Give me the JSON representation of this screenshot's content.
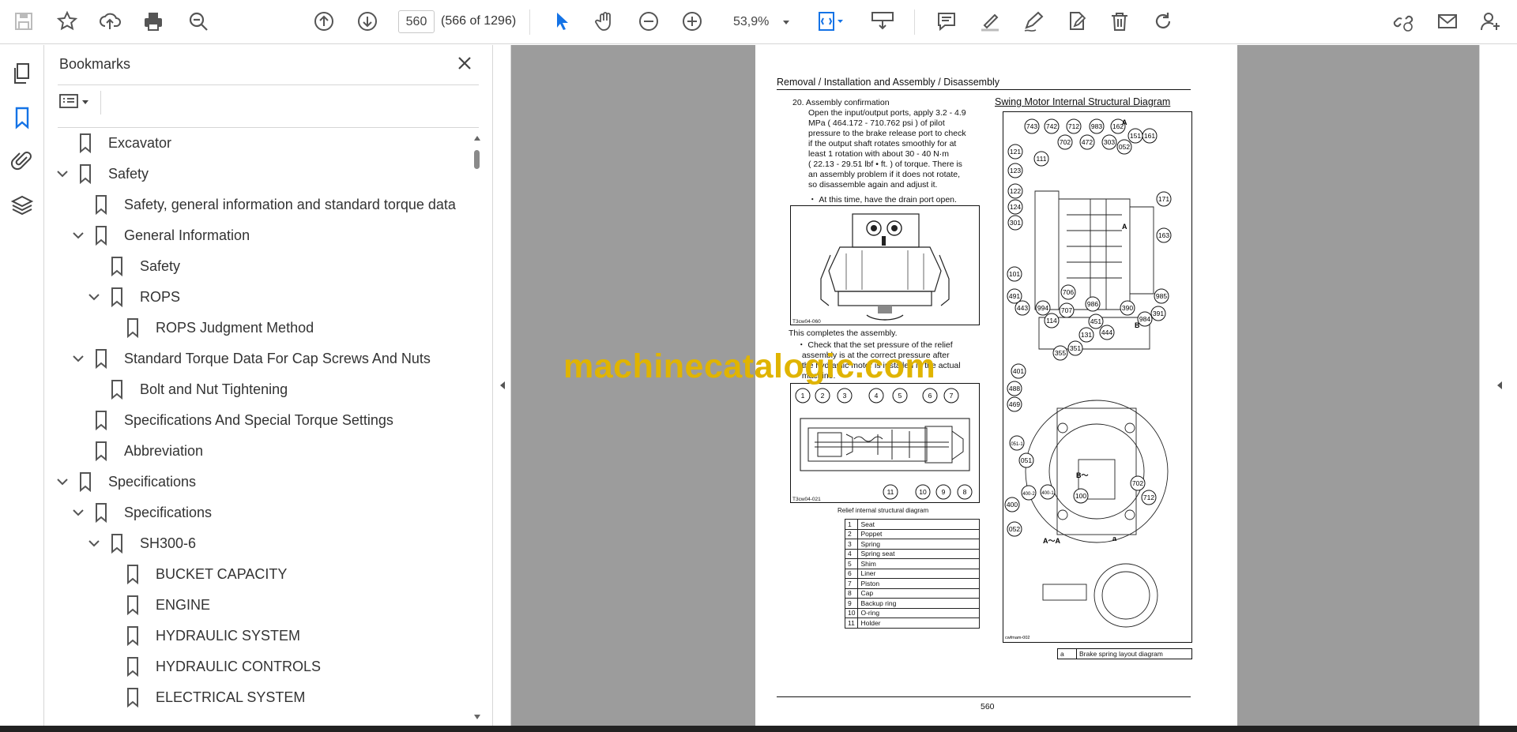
{
  "toolbar": {
    "page_current": "560",
    "page_count": "(566 of 1296)",
    "zoom": "53,9%",
    "icons": [
      "save-icon",
      "star-icon",
      "upload-icon",
      "print-icon",
      "zoom-search-icon",
      "page-up-icon",
      "page-down-icon",
      "select-arrow-icon",
      "hand-icon",
      "zoom-out-icon",
      "zoom-in-icon",
      "fit-page-icon",
      "scroll-mode-icon",
      "comment-icon",
      "highlight-icon",
      "draw-icon",
      "edit-pdf-icon",
      "delete-icon",
      "rotate-icon",
      "share-link-icon",
      "email-icon",
      "account-icon"
    ]
  },
  "panel": {
    "title": "Bookmarks",
    "items": [
      {
        "label": "Excavator",
        "level": 0,
        "expanded": null
      },
      {
        "label": "Safety",
        "level": 0,
        "expanded": true
      },
      {
        "label": "Safety, general information and standard torque data",
        "level": 1,
        "expanded": null
      },
      {
        "label": "General Information",
        "level": 1,
        "expanded": true
      },
      {
        "label": "Safety",
        "level": 2,
        "expanded": null
      },
      {
        "label": "ROPS",
        "level": 2,
        "expanded": true
      },
      {
        "label": "ROPS Judgment Method",
        "level": 3,
        "expanded": null
      },
      {
        "label": "Standard Torque Data For Cap Screws And Nuts",
        "level": 1,
        "expanded": true
      },
      {
        "label": "Bolt and Nut Tightening",
        "level": 2,
        "expanded": null
      },
      {
        "label": "Specifications And Special Torque Settings",
        "level": 1,
        "expanded": null
      },
      {
        "label": "Abbreviation",
        "level": 1,
        "expanded": null
      },
      {
        "label": "Specifications",
        "level": 0,
        "expanded": true
      },
      {
        "label": "Specifications",
        "level": 1,
        "expanded": true
      },
      {
        "label": "SH300-6",
        "level": 2,
        "expanded": true
      },
      {
        "label": "BUCKET CAPACITY",
        "level": 3,
        "expanded": null
      },
      {
        "label": "ENGINE",
        "level": 3,
        "expanded": null
      },
      {
        "label": "HYDRAULIC SYSTEM",
        "level": 3,
        "expanded": null
      },
      {
        "label": "HYDRAULIC CONTROLS",
        "level": 3,
        "expanded": null
      },
      {
        "label": "ELECTRICAL SYSTEM",
        "level": 3,
        "expanded": null
      }
    ]
  },
  "page": {
    "header": "Removal / Installation and Assembly / Disassembly",
    "step": "20.  Assembly confirmation",
    "para": [
      "Open the input/output ports, apply 3.2 - 4.9",
      "MPa ( 464.172 - 710.762 psi ) of pilot",
      "pressure to the brake release port to check",
      "if the output shaft rotates smoothly for at",
      "least 1 rotation with about 30 - 40 N·m",
      "( 22.13 - 29.51 lbf • ft. ) of torque. There is",
      "an assembly problem if it does not rotate,",
      "so disassemble again and adjust it."
    ],
    "note1": "・ At this time, have the drain port open.",
    "fig1_code": "T3cw04-060",
    "completes": "This completes the assembly.",
    "note2": [
      "・ Check that the set pressure of the relief",
      "  assembly is at the correct pressure after",
      "  the hydraulic motor is installed in the actual",
      "  machine."
    ],
    "fig2_code": "T3cw04-021",
    "fig2_caption": "Relief internal structural diagram",
    "relief_callouts": [
      "1",
      "2",
      "3",
      "4",
      "5",
      "6",
      "7",
      "8",
      "9",
      "10",
      "11"
    ],
    "parts": [
      [
        "1",
        "Seat"
      ],
      [
        "2",
        "Poppet"
      ],
      [
        "3",
        "Spring"
      ],
      [
        "4",
        "Spring seat"
      ],
      [
        "5",
        "Shim"
      ],
      [
        "6",
        "Liner"
      ],
      [
        "7",
        "Piston"
      ],
      [
        "8",
        "Cap"
      ],
      [
        "9",
        "Backup ring"
      ],
      [
        "10",
        "O-ring"
      ],
      [
        "11",
        "Holder"
      ]
    ],
    "right_title": "Swing Motor Internal Structural Diagram",
    "callouts_top": [
      "743",
      "742",
      "712",
      "983",
      "162",
      "151",
      "161",
      "702",
      "472",
      "303",
      "052",
      "111",
      "121",
      "123",
      "122",
      "124",
      "301",
      "171",
      "163",
      "101",
      "491",
      "443",
      "994",
      "114",
      "706",
      "707",
      "986",
      "131",
      "451",
      "444",
      "390",
      "984",
      "391",
      "985"
    ],
    "label_A": "A",
    "label_B": "B",
    "callouts_mid": [
      "355",
      "351",
      "401",
      "488",
      "469",
      "051-1",
      "051"
    ],
    "label_Bview": "B～",
    "callouts_bot": [
      "400-2",
      "400-1",
      "100",
      "400",
      "052",
      "702",
      "712"
    ],
    "label_AA": "A～A",
    "label_a": "a",
    "right_code": "cwfmam-002",
    "legend_key": "a",
    "legend_text": "Brake spring layout diagram",
    "page_number": "560"
  },
  "watermark": "machinecatalogic.com",
  "colors": {
    "accent": "#1473e6",
    "watermark": "#e0b400",
    "doc_bg": "#9c9c9c"
  }
}
